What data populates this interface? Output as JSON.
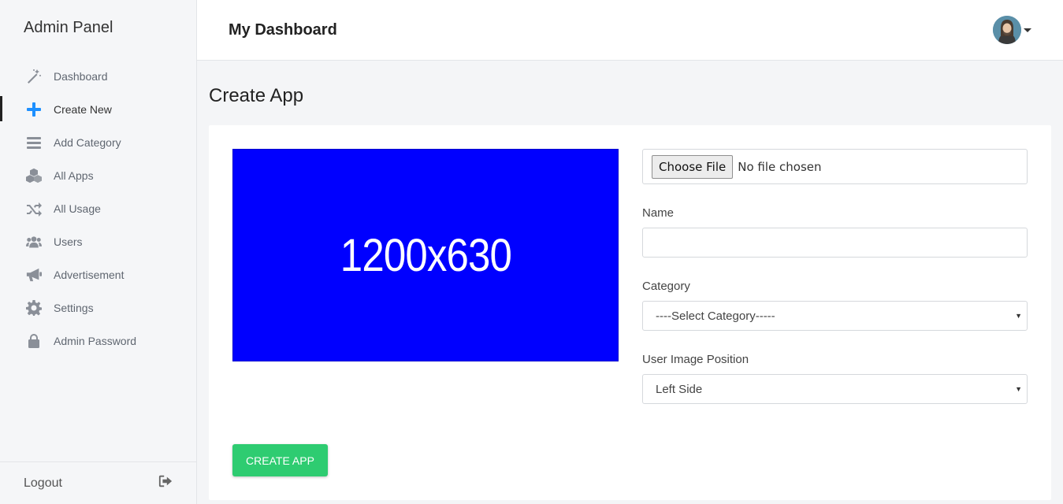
{
  "sidebar": {
    "brand": "Admin Panel",
    "items": [
      {
        "label": "Dashboard",
        "icon": "magic-wand-icon"
      },
      {
        "label": "Create New",
        "icon": "plus-icon",
        "active": true
      },
      {
        "label": "Add Category",
        "icon": "bars-icon"
      },
      {
        "label": "All Apps",
        "icon": "cubes-icon"
      },
      {
        "label": "All Usage",
        "icon": "shuffle-icon"
      },
      {
        "label": "Users",
        "icon": "users-icon"
      },
      {
        "label": "Advertisement",
        "icon": "bullhorn-icon"
      },
      {
        "label": "Settings",
        "icon": "gear-icon"
      },
      {
        "label": "Admin Password",
        "icon": "lock-icon"
      }
    ],
    "logout_label": "Logout"
  },
  "header": {
    "title": "My Dashboard"
  },
  "main": {
    "page_title": "Create App",
    "preview_text": "1200x630",
    "preview_color": "#0000ff",
    "form": {
      "file_button": "Choose File",
      "file_status": "No file chosen",
      "name_label": "Name",
      "name_value": "",
      "category_label": "Category",
      "category_value": "----Select Category-----",
      "position_label": "User Image Position",
      "position_value": "Left Side"
    },
    "submit_label": "CREATE APP",
    "submit_color": "#2ecc71"
  }
}
